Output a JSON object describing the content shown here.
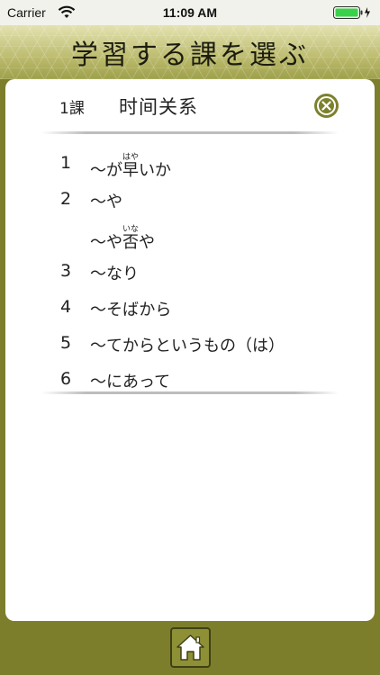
{
  "status_bar": {
    "carrier": "Carrier",
    "time": "11:09 AM",
    "wifi_icon": "wifi-icon",
    "battery_icon": "battery-full-icon"
  },
  "header": {
    "title": "学習する課を選ぶ"
  },
  "lesson": {
    "number": "1課",
    "title": "时间关系",
    "close_icon": "close-circle-icon"
  },
  "items": [
    {
      "number": "1",
      "prefix": "〜が",
      "ruby_base": "早",
      "ruby_text": "はや",
      "suffix": "いか"
    },
    {
      "number": "2",
      "text": "〜や"
    },
    {
      "number": "",
      "prefix": "〜や",
      "ruby_base": "否",
      "ruby_text": "いな",
      "suffix": "や"
    },
    {
      "number": "3",
      "text": "〜なり"
    },
    {
      "number": "4",
      "text": "〜そばから"
    },
    {
      "number": "5",
      "text": "〜てからというもの（は）"
    },
    {
      "number": "6",
      "text": "〜にあって"
    }
  ],
  "colors": {
    "accent_olive": "#7c7e2c",
    "panel": "#ffffff",
    "header_light": "#e3e2b0"
  },
  "footer": {
    "home_icon": "home-icon"
  }
}
